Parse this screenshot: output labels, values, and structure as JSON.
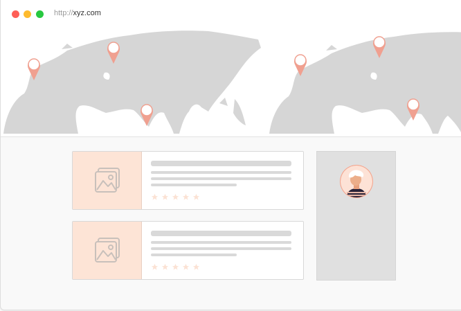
{
  "window": {
    "controls": [
      "close",
      "minimize",
      "maximize"
    ],
    "colors": {
      "close": "#fe5f57",
      "minimize": "#febb2e",
      "maximize": "#28c840"
    }
  },
  "address_bar": {
    "protocol": "http://",
    "host": "xyz.com"
  },
  "map": {
    "land_color": "#d6d6d6",
    "pin_color": "#f0a090",
    "pins": [
      "pin-western-europe",
      "pin-russia",
      "pin-india",
      "pin-eastern-europe",
      "pin-siberia",
      "pin-southeast-asia"
    ]
  },
  "listings": [
    {
      "thumb_icon": "image-placeholder-icon",
      "rating_stars": 5
    },
    {
      "thumb_icon": "image-placeholder-icon",
      "rating_stars": 5
    }
  ],
  "profile": {
    "avatar_icon": "user-avatar-icon"
  },
  "colors": {
    "accent": "#fde4d6",
    "skeleton": "#d9d9d9",
    "star": "#fbe2d4"
  }
}
